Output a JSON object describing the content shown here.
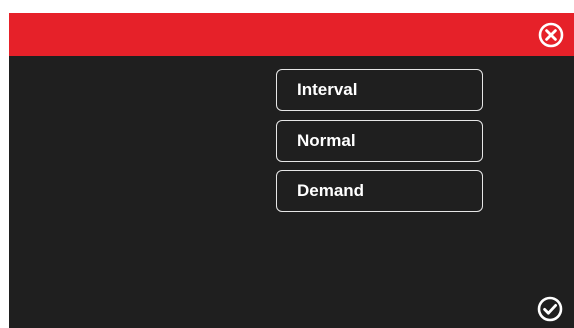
{
  "header": {
    "close_icon": "close-circle-icon",
    "accent_color": "#e62129"
  },
  "options": [
    {
      "label": "Interval"
    },
    {
      "label": "Normal"
    },
    {
      "label": "Demand"
    }
  ],
  "footer": {
    "confirm_icon": "check-circle-icon"
  },
  "colors": {
    "background": "#1f1f1f",
    "header": "#e62129",
    "option_border": "#e6e6e6",
    "text": "#ffffff"
  }
}
